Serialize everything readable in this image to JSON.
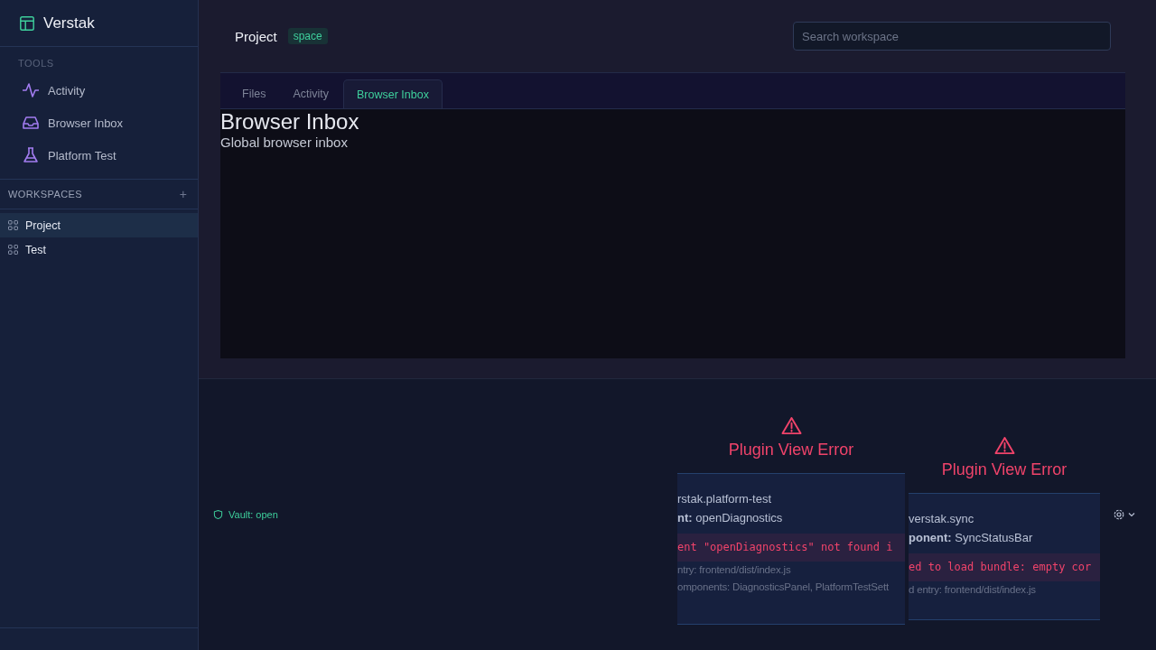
{
  "app": {
    "name": "Verstak"
  },
  "sidebar": {
    "tools_heading": "TOOLS",
    "tools": [
      {
        "label": "Activity",
        "kind": "activity"
      },
      {
        "label": "Browser Inbox",
        "kind": "inbox"
      },
      {
        "label": "Platform Test",
        "kind": "flask"
      }
    ],
    "workspaces_heading": "WORKSPACES",
    "add": "+",
    "workspaces": [
      {
        "label": "Project",
        "selected": true
      },
      {
        "label": "Test",
        "selected": false
      }
    ]
  },
  "header": {
    "title": "Project",
    "badge": "space",
    "search": {
      "placeholder": "Search workspace"
    }
  },
  "tabs": [
    {
      "label": "Files",
      "selected": false
    },
    {
      "label": "Activity",
      "selected": false
    },
    {
      "label": "Browser Inbox",
      "selected": true
    }
  ],
  "view": {
    "title": "Browser Inbox",
    "subtitle": "Global browser inbox"
  },
  "status_bar": {
    "vault": "Vault: open",
    "errors": [
      {
        "title": "Plugin View Error",
        "plugin": "rstak.platform-test",
        "component": "**nt:** openDiagnostics",
        "message": "ent \"openDiagnostics\" not found i",
        "details": [
          "ntry: frontend/dist/index.js",
          "omponents: DiagnosticsPanel, PlatformTestSett"
        ]
      },
      {
        "title": "Plugin View Error",
        "plugin": "verstak.sync",
        "component": "**ponent:** SyncStatusBar",
        "message": "ed to load bundle: empty cor",
        "details": [
          "d entry: frontend/dist/index.js"
        ]
      }
    ]
  }
}
